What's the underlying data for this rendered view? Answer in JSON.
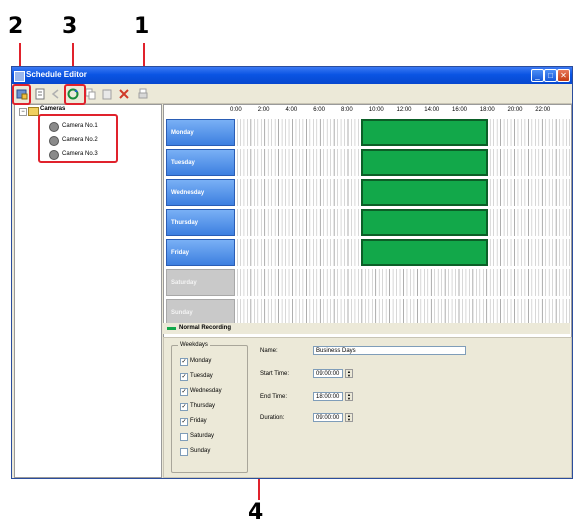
{
  "callouts": [
    "2",
    "3",
    "1",
    "4"
  ],
  "window": {
    "title": "Schedule Editor",
    "controls": [
      "_",
      "□",
      "✕"
    ]
  },
  "tree": {
    "root_label": "Cameras",
    "items": [
      "Camera No.1",
      "Camera No.2",
      "Camera No.3"
    ]
  },
  "time_header": [
    "0:00",
    "2:00",
    "4:00",
    "6:00",
    "8:00",
    "10:00",
    "12:00",
    "14:00",
    "16:00",
    "18:00",
    "20:00",
    "22:00"
  ],
  "days": [
    {
      "label": "Monday",
      "enabled": true
    },
    {
      "label": "Tuesday",
      "enabled": true
    },
    {
      "label": "Wednesday",
      "enabled": true
    },
    {
      "label": "Thursday",
      "enabled": true
    },
    {
      "label": "Friday",
      "enabled": true
    },
    {
      "label": "Saturday",
      "enabled": false
    },
    {
      "label": "Sunday",
      "enabled": false
    }
  ],
  "legend": {
    "label": "Normal Recording",
    "color": "#12a84a"
  },
  "detail": {
    "weekdays_title": "Weekdays",
    "weekdays": [
      {
        "label": "Monday",
        "checked": true
      },
      {
        "label": "Tuesday",
        "checked": true
      },
      {
        "label": "Wednesday",
        "checked": true
      },
      {
        "label": "Thursday",
        "checked": true
      },
      {
        "label": "Friday",
        "checked": true
      },
      {
        "label": "Saturday",
        "checked": false
      },
      {
        "label": "Sunday",
        "checked": false
      }
    ],
    "name_label": "Name:",
    "name_value": "Business Days",
    "start_label": "Start Time:",
    "start_value": "09:00:00",
    "end_label": "End Time:",
    "end_value": "18:00:00",
    "duration_label": "Duration:",
    "duration_value": "09:00:00"
  },
  "colors": {
    "accent": "#e0222c",
    "title_bar": "#0a54e3",
    "day_active": "#3d7fe0"
  }
}
